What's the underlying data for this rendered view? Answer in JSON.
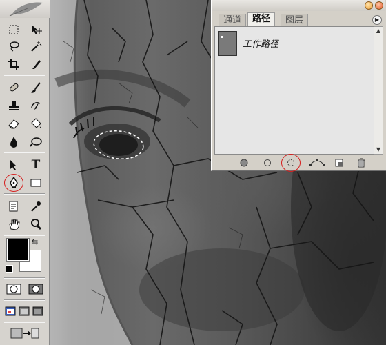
{
  "panel": {
    "tabs": [
      {
        "label": "通道",
        "active": false
      },
      {
        "label": "路径",
        "active": true
      },
      {
        "label": "图层",
        "active": false
      }
    ],
    "paths": [
      {
        "name": "工作路径"
      }
    ],
    "menu_icon": "▶"
  },
  "toolbox": {
    "tools_left": [
      "marquee-tool-icon",
      "lasso-tool-icon",
      "crop-tool-icon",
      "healing-brush-icon",
      "clone-stamp-icon",
      "eraser-icon",
      "blur-icon",
      "path-select-icon",
      "pen-tool-icon",
      "notes-icon",
      "hand-icon"
    ],
    "tools_right": [
      "move-tool-icon",
      "magic-wand-icon",
      "slice-icon",
      "brush-icon",
      "history-brush-icon",
      "paint-bucket-icon",
      "dodge-icon",
      "type-tool-icon",
      "shape-tool-icon",
      "eyedropper-icon",
      "zoom-icon"
    ],
    "type_tool_glyph": "T",
    "swap_glyph": "⇆"
  },
  "colors": {
    "foreground": "#000000",
    "background": "#ffffff",
    "highlight_circle": "#d61e1e"
  },
  "panel_buttons": [
    "fill-path-icon",
    "stroke-path-icon",
    "load-selection-icon",
    "make-work-path-icon",
    "new-path-icon",
    "delete-path-icon"
  ]
}
